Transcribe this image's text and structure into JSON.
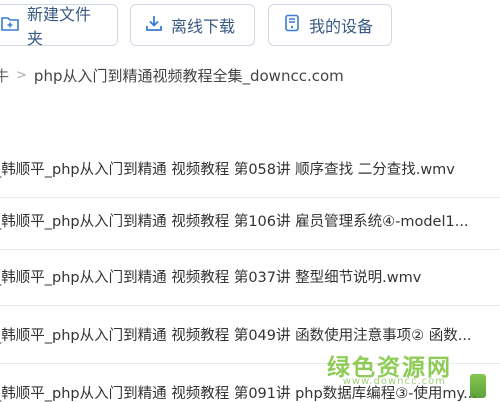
{
  "toolbar": {
    "new_folder_label": "新建文件夹",
    "offline_download_label": "离线下载",
    "my_device_label": "我的设备"
  },
  "breadcrumb": {
    "root": "牛",
    "separator": ">",
    "current": "php从入门到精通视频教程全集_downcc.com"
  },
  "files": [
    {
      "name": "_韩顺平_php从入门到精通 视频教程 第058讲 顺序查找 二分查找.wmv"
    },
    {
      "name": "_韩顺平_php从入门到精通 视频教程 第106讲 雇员管理系统④-model1..."
    },
    {
      "name": "_韩顺平_php从入门到精通 视频教程 第037讲 整型细节说明.wmv"
    },
    {
      "name": "_韩顺平_php从入门到精通 视频教程 第049讲 函数使用注意事项② 函数..."
    },
    {
      "name": "_韩顺平_php从入门到精通 视频教程 第091讲 php数据库编程③-使用my..."
    }
  ],
  "watermark": {
    "text": "绿色资源网",
    "url": "www.downcc.com"
  },
  "colors": {
    "button_text": "#3a5a85",
    "button_border": "#cfd8e3",
    "watermark_green": "#7cc43a"
  },
  "icons": {
    "new_folder": "folder-plus-icon",
    "offline_download": "download-icon",
    "my_device": "device-icon"
  }
}
